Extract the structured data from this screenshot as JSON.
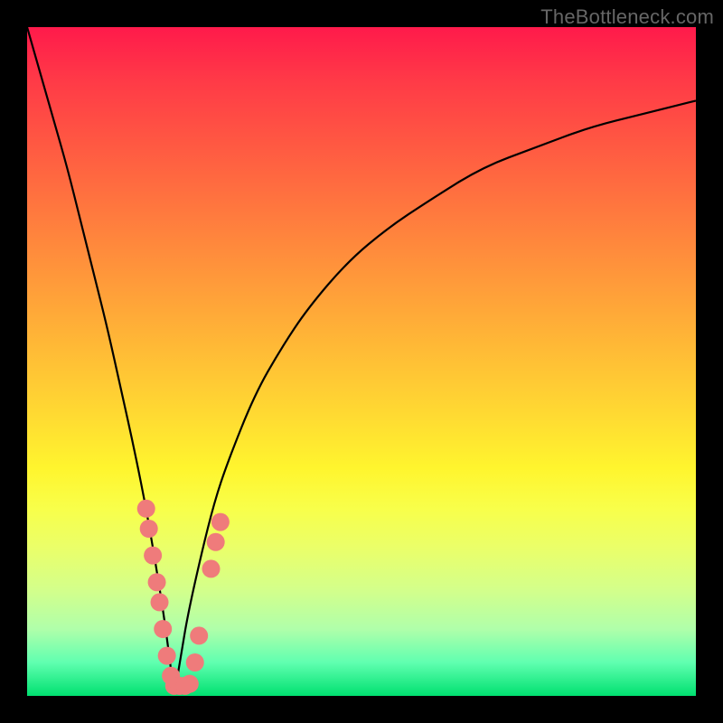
{
  "watermark": "TheBottleneck.com",
  "colors": {
    "frame": "#000000",
    "gradient_top": "#ff1a4b",
    "gradient_bottom": "#00e070",
    "curve": "#000000",
    "dots": "#ef7b7b"
  },
  "chart_data": {
    "type": "line",
    "title": "",
    "xlabel": "",
    "ylabel": "",
    "xlim": [
      0,
      100
    ],
    "ylim": [
      0,
      100
    ],
    "x_min_point": 22,
    "series": [
      {
        "name": "bottleneck-curve",
        "x": [
          0,
          2,
          4,
          6,
          8,
          10,
          12,
          14,
          16,
          18,
          20,
          21,
          22,
          23,
          24,
          26,
          28,
          30,
          34,
          38,
          42,
          48,
          54,
          60,
          68,
          76,
          84,
          92,
          100
        ],
        "values": [
          100,
          93,
          86,
          79,
          71,
          63,
          55,
          46,
          37,
          27,
          15,
          8,
          0,
          6,
          12,
          21,
          29,
          35,
          45,
          52,
          58,
          65,
          70,
          74,
          79,
          82,
          85,
          87,
          89
        ]
      }
    ],
    "scatter": [
      {
        "x": 17.8,
        "y": 28
      },
      {
        "x": 18.2,
        "y": 25
      },
      {
        "x": 18.8,
        "y": 21
      },
      {
        "x": 19.4,
        "y": 17
      },
      {
        "x": 19.8,
        "y": 14
      },
      {
        "x": 20.3,
        "y": 10
      },
      {
        "x": 20.9,
        "y": 6
      },
      {
        "x": 21.5,
        "y": 3
      },
      {
        "x": 22.0,
        "y": 1.5
      },
      {
        "x": 22.8,
        "y": 1.5
      },
      {
        "x": 23.6,
        "y": 1.5
      },
      {
        "x": 24.3,
        "y": 1.8
      },
      {
        "x": 25.1,
        "y": 5
      },
      {
        "x": 25.7,
        "y": 9
      },
      {
        "x": 27.5,
        "y": 19
      },
      {
        "x": 28.2,
        "y": 23
      },
      {
        "x": 28.9,
        "y": 26
      }
    ],
    "dot_radius_px": 10
  }
}
